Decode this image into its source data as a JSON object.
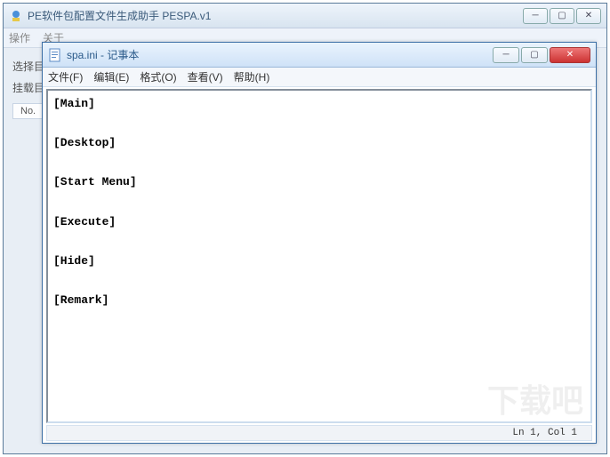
{
  "back": {
    "title": "PE软件包配置文件生成助手 PESPA.v1",
    "menu": {
      "op": "操作",
      "about": "关于"
    },
    "labels": {
      "select": "选择目",
      "mount": "挂载目",
      "no": "No."
    }
  },
  "front": {
    "title": "spa.ini - 记事本",
    "menu": {
      "file": "文件(F)",
      "edit": "编辑(E)",
      "format": "格式(O)",
      "view": "查看(V)",
      "help": "帮助(H)"
    },
    "content": {
      "lines": [
        "[Main]",
        "",
        "[Desktop]",
        "",
        "[Start Menu]",
        "",
        "[Execute]",
        "",
        "[Hide]",
        "",
        "[Remark]"
      ]
    },
    "status": "Ln 1, Col 1"
  },
  "controls": {
    "min": "─",
    "max": "▢",
    "close": "✕"
  }
}
